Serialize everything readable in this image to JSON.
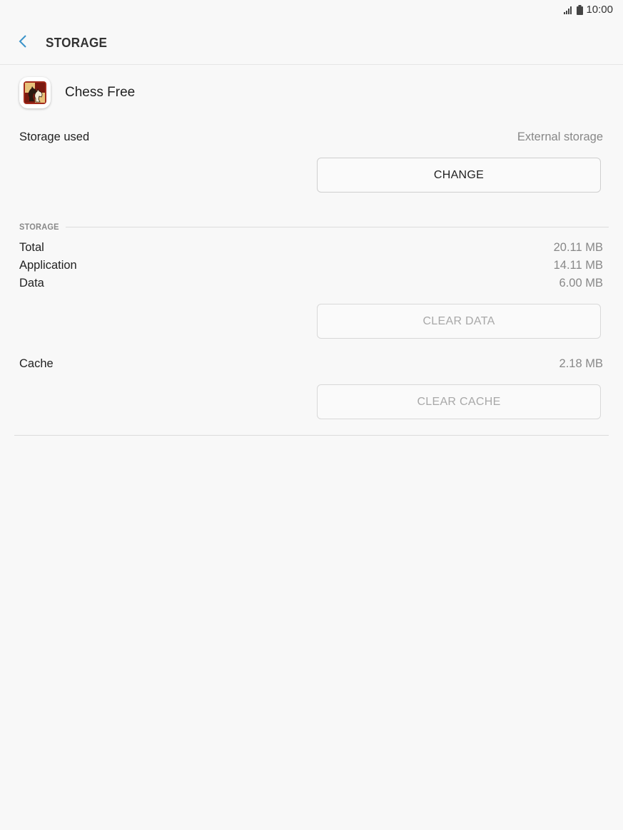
{
  "status_bar": {
    "time": "10:00",
    "icons": [
      "signal-icon",
      "battery-icon"
    ]
  },
  "header": {
    "title": "STORAGE",
    "back_icon": "chevron-left-icon",
    "accent_color": "#3a93c9"
  },
  "app": {
    "name": "Chess Free",
    "icon": "chess-app-icon"
  },
  "storage_used": {
    "label": "Storage used",
    "value": "External storage",
    "button_label": "CHANGE"
  },
  "storage": {
    "section_label": "STORAGE",
    "rows": [
      {
        "label": "Total",
        "value": "20.11 MB"
      },
      {
        "label": "Application",
        "value": "14.11 MB"
      },
      {
        "label": "Data",
        "value": "6.00 MB"
      }
    ],
    "clear_data_label": "CLEAR DATA"
  },
  "cache": {
    "label": "Cache",
    "value": "2.18 MB",
    "button_label": "CLEAR CACHE"
  }
}
